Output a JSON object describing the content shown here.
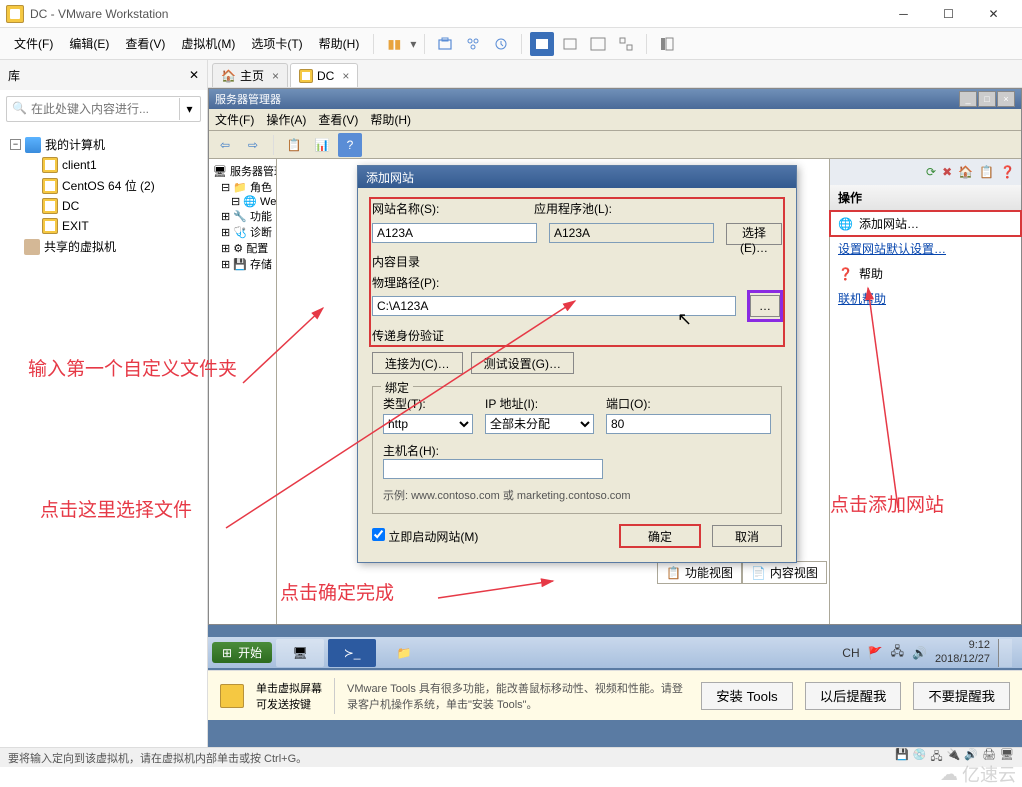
{
  "titlebar": {
    "title": "DC - VMware Workstation"
  },
  "menubar": {
    "items": [
      "文件(F)",
      "编辑(E)",
      "查看(V)",
      "虚拟机(M)",
      "选项卡(T)",
      "帮助(H)"
    ]
  },
  "library": {
    "header": "库",
    "search_placeholder": "在此处键入内容进行...",
    "tree": {
      "root": "我的计算机",
      "vms": [
        "client1",
        "CentOS 64 位 (2)",
        "DC",
        "EXIT"
      ],
      "shared": "共享的虚拟机"
    }
  },
  "vm_tabs": {
    "home": "主页",
    "dc": "DC"
  },
  "server_manager": {
    "title": "服务器管理器",
    "menu": [
      "文件(F)",
      "操作(A)",
      "查看(V)",
      "帮助(H)"
    ],
    "tree": {
      "title": "服务器管理器",
      "roles": "角色",
      "web": "We",
      "items": [
        "功能",
        "诊断",
        "配置",
        "存储"
      ]
    },
    "actions": {
      "header": "操作",
      "add_site": "添加网站…",
      "set_defaults": "设置网站默认设置…",
      "help": "帮助",
      "online_help": "联机帮助"
    }
  },
  "dialog": {
    "title": "添加网站",
    "site_name_label": "网站名称(S):",
    "site_name_value": "A123A",
    "app_pool_label": "应用程序池(L):",
    "app_pool_value": "A123A",
    "select_btn": "选择(E)…",
    "content_group": "内容目录",
    "phys_path_label": "物理路径(P):",
    "phys_path_value": "C:\\A123A",
    "browse_btn": "…",
    "cred_label": "传递身份验证",
    "connect_as_btn": "连接为(C)…",
    "test_settings_btn": "测试设置(G)…",
    "binding_group": "绑定",
    "type_label": "类型(T):",
    "type_value": "http",
    "ip_label": "IP 地址(I):",
    "ip_value": "全部未分配",
    "port_label": "端口(O):",
    "port_value": "80",
    "host_label": "主机名(H):",
    "host_value": "",
    "example": "示例: www.contoso.com 或 marketing.contoso.com",
    "autostart_label": "立即启动网站(M)",
    "ok_btn": "确定",
    "cancel_btn": "取消"
  },
  "view_tabs": {
    "feature": "功能视图",
    "content": "内容视图"
  },
  "guest_taskbar": {
    "start": "开始",
    "time": "9:12",
    "date": "2018/12/27"
  },
  "vmtools": {
    "hint_title": "单击虚拟屏幕\n可发送按键",
    "description": "VMware Tools 具有很多功能，能改善鼠标移动性、视频和性能。请登录客户机操作系统，单击\"安装 Tools\"。",
    "install_btn": "安装 Tools",
    "remind_later_btn": "以后提醒我",
    "never_remind_btn": "不要提醒我"
  },
  "annotations": {
    "a1": "输入第一个自定义文件夹",
    "a2": "点击这里选择文件",
    "a3": "点击确定完成",
    "a4": "点击添加网站"
  },
  "host_status": {
    "text": "要将输入定向到该虚拟机，请在虚拟机内部单击或按 Ctrl+G。",
    "ime": "CH"
  },
  "watermark": "亿速云"
}
